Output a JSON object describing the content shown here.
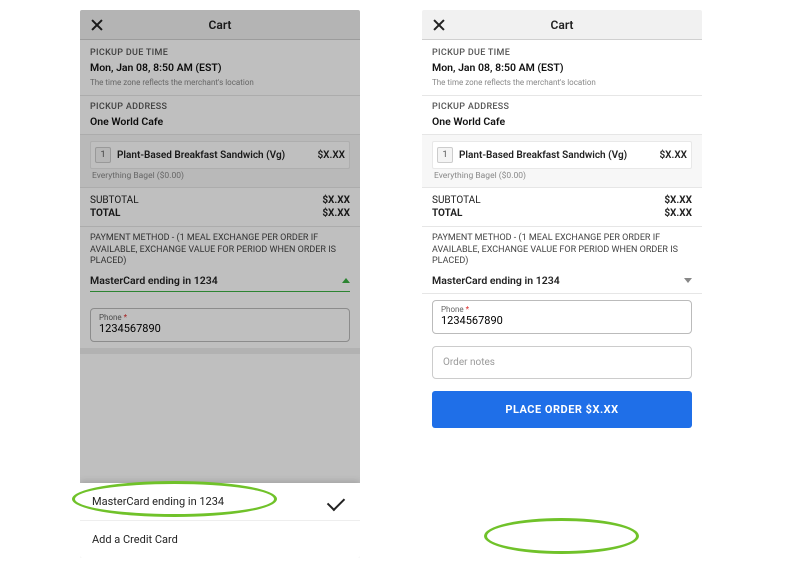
{
  "header": {
    "title": "Cart"
  },
  "pickup_time": {
    "label": "PICKUP DUE TIME",
    "value": "Mon, Jan 08, 8:50 AM (EST)",
    "note": "The time zone reflects the merchant's location"
  },
  "pickup_address": {
    "label": "PICKUP ADDRESS",
    "value": "One World Cafe"
  },
  "item": {
    "qty": "1",
    "name": "Plant-Based Breakfast Sandwich (Vg)",
    "price": "$X.XX",
    "mod": "Everything Bagel ($0.00)"
  },
  "totals": {
    "subtotal_label": "SUBTOTAL",
    "subtotal_value": "$X.XX",
    "total_label": "TOTAL",
    "total_value": "$X.XX"
  },
  "payment": {
    "label": "PAYMENT METHOD - (1 MEAL EXCHANGE PER ORDER IF AVAILABLE, EXCHANGE VALUE FOR PERIOD WHEN ORDER IS PLACED)",
    "selected": "MasterCard ending in 1234"
  },
  "phone_field": {
    "label": "Phone",
    "required_mark": "*",
    "value": "1234567890"
  },
  "notes": {
    "placeholder": "Order notes"
  },
  "sheet": {
    "option_card": "MasterCard ending in 1234",
    "option_add": "Add a Credit Card"
  },
  "cta": {
    "label": "PLACE ORDER $X.XX"
  }
}
